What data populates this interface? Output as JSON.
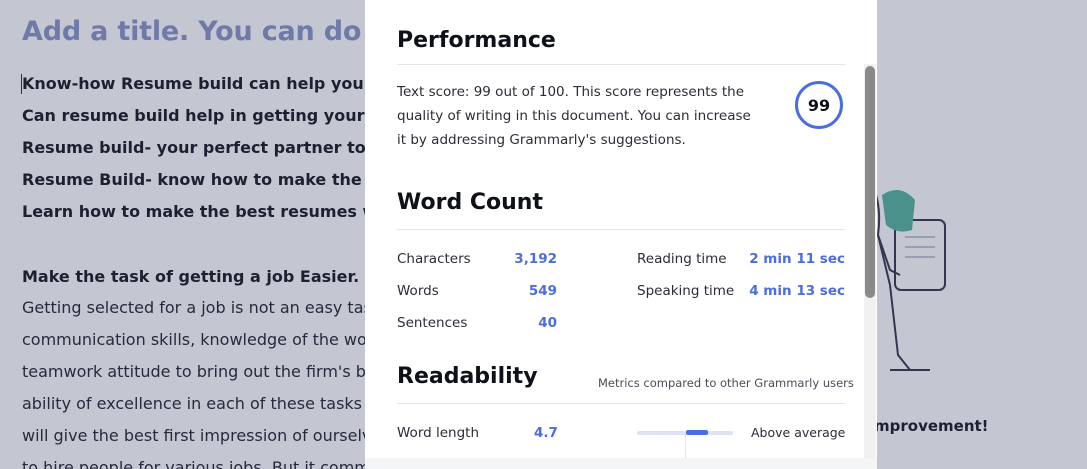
{
  "document": {
    "title": "Add a title. You can do this",
    "headline_lines": [
      "Know-how Resume build can help you in getting",
      "Can resume build help in getting your dream job",
      "Resume build- your perfect partner to make",
      "Resume Build- know how to make the best",
      "Learn how to make the best resumes with"
    ],
    "subheading": "Make the task of getting a job Easier.",
    "body_lines": [
      "Getting selected for a job is not an easy task",
      "communication skills, knowledge of the work",
      "teamwork attitude to bring out the firm's best",
      "ability of excellence in each of these tasks",
      "will give the best first impression of ourselves",
      "to hire people for various jobs. But it comm"
    ],
    "illustration_caption": "mprovement!"
  },
  "modal": {
    "performance": {
      "title": "Performance",
      "text": "Text score: 99 out of 100. This score represents the quality of writing in this document. You can increase it by addressing Grammarly's suggestions.",
      "score": "99"
    },
    "word_count": {
      "title": "Word Count",
      "stats": [
        {
          "label": "Characters",
          "value": "3,192"
        },
        {
          "label": "Words",
          "value": "549"
        },
        {
          "label": "Sentences",
          "value": "40"
        },
        {
          "label": "Reading time",
          "value": "2 min 11 sec"
        },
        {
          "label": "Speaking time",
          "value": "4 min 13 sec"
        }
      ]
    },
    "readability": {
      "title": "Readability",
      "note": "Metrics compared to other Grammarly users",
      "metrics": [
        {
          "label": "Word length",
          "value": "4.7",
          "rating": "Above average",
          "level": 0.55
        }
      ]
    }
  },
  "colors": {
    "accent": "#4a6ee0",
    "title_muted": "#8e99c8",
    "text": "#0e101a"
  }
}
